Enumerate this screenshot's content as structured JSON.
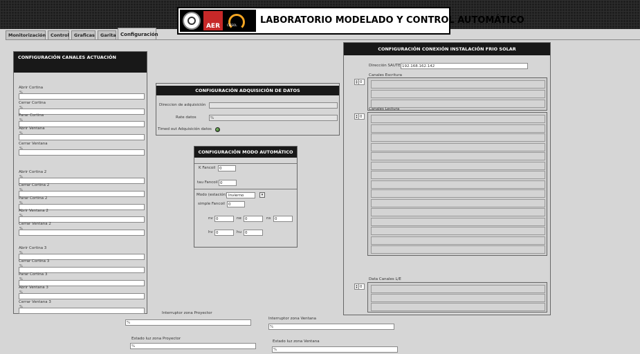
{
  "header": {
    "title": "LABORATORIO MODELADO Y CONTROL AUTOMÁTICO",
    "logo_aer": "AER",
    "logo_ciesol": "CIESOL"
  },
  "tabs": [
    "Monitorización",
    "Control",
    "Graficas",
    "Garita",
    "Configuración"
  ],
  "actuacion": {
    "title": "CONFIGURACIÓN CANALES ACTUACIÓN",
    "fields": [
      "Abrir Cortina",
      "Cerrar Cortina",
      "Parar Cortina",
      "Abrir Ventana",
      "Cerrar Ventana",
      "Abrir Cortina 2",
      "Cerrar Cortina 2",
      "Parar Cortina 2",
      "Abrir Ventana 2",
      "Cerrar Ventana 2",
      "Abrir Cortina 3",
      "Cerrar Cortina 3",
      "Parar Cortina 3",
      "Abrir Ventana 3",
      "Cerrar Ventana 3"
    ]
  },
  "adquisicion": {
    "title": "CONFIGURACIÓN ADQUISICIÓN DE DATOS",
    "direccion_label": "Direccion de adquisición",
    "rate_label": "Rate datos",
    "timeout_label": "Timed out Adquisición datos"
  },
  "automatico": {
    "title": "CONFIGURACIÓN MODO AUTOMÁTICO",
    "k_label": "K Fancoil",
    "k_value": "0",
    "tau_label": "tau Fancoil",
    "tau_value": "0",
    "modo_label": "Modo (estación)",
    "modo_value": "Invierno",
    "simple_label": "simple Fancoil",
    "simple_value": "0",
    "nv_label": "nv",
    "nv_value": "0",
    "ne_label": "ne",
    "ne_value": "0",
    "ns_label": "ns",
    "ns_value": "0",
    "hv_label": "hv",
    "hv_value": "0",
    "hu_label": "hu",
    "hu_value": "0"
  },
  "frio": {
    "title": "CONFIGURACIÓN CONEXIÓN INSTALACIÓN FRIO SOLAR",
    "sauter_label": "Dirección SAUTER",
    "sauter_value": "192.168.162.142",
    "escritura_label": "Canales Escritura",
    "lectura_label": "Canales Lectura",
    "data_label": "Data Canales L/E",
    "index_value": "0"
  },
  "bottom": {
    "proyector_label": "Interruptor zona Proyector",
    "ventana_label": "Interruptor zona Ventana",
    "luz_proyector_label": "Estado luz zona Proyector",
    "luz_ventana_label": "Estado luz zona Ventana"
  },
  "ind": "%"
}
